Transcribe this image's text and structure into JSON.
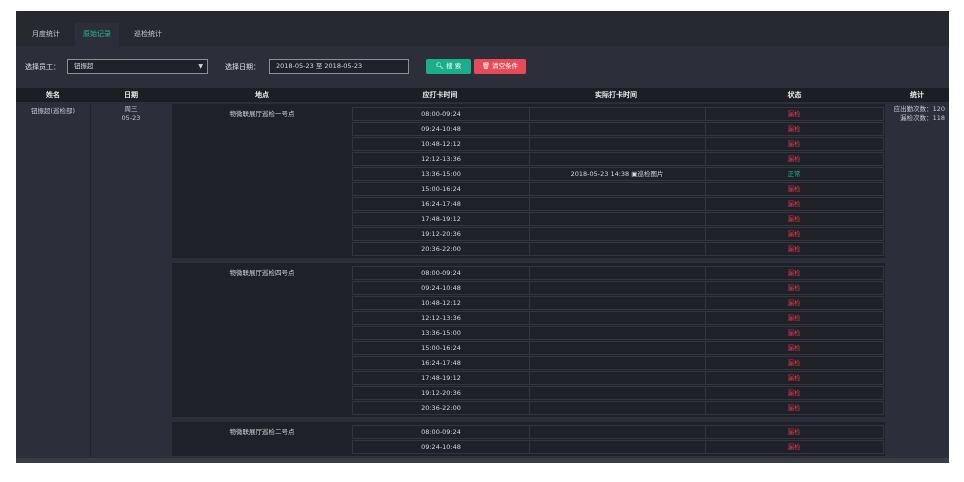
{
  "tabs": [
    "月度统计",
    "原始记录",
    "巡检统计"
  ],
  "active_tab": 1,
  "filter": {
    "employee_label": "选择员工：",
    "employee_value": "钮振超",
    "date_label": "选择日期：",
    "date_value": "2018-05-23 至 2018-05-23",
    "search_label": "搜 索",
    "clear_label": "清空条件"
  },
  "table": {
    "headers": [
      "姓名",
      "日期",
      "地点",
      "应打卡时间",
      "实际打卡时间",
      "状态",
      "统计"
    ],
    "name": "钮振超(巡检部)",
    "weekday": "周三",
    "date": "05-23",
    "stats": [
      "应出勤次数：120",
      "漏检次数：118"
    ],
    "locations": [
      {
        "name": "物微联展厅巡检一号点",
        "rows": [
          {
            "time": "08:00-09:24",
            "actual": "",
            "status": "漏检"
          },
          {
            "time": "09:24-10:48",
            "actual": "",
            "status": "漏检"
          },
          {
            "time": "10:48-12:12",
            "actual": "",
            "status": "漏检"
          },
          {
            "time": "12:12-13:36",
            "actual": "",
            "status": "漏检"
          },
          {
            "time": "13:36-15:00",
            "actual": "2018-05-23 14:38  ▣巡检图片",
            "status": "正常"
          },
          {
            "time": "15:00-16:24",
            "actual": "",
            "status": "漏检"
          },
          {
            "time": "16:24-17:48",
            "actual": "",
            "status": "漏检"
          },
          {
            "time": "17:48-19:12",
            "actual": "",
            "status": "漏检"
          },
          {
            "time": "19:12-20:36",
            "actual": "",
            "status": "漏检"
          },
          {
            "time": "20:36-22:00",
            "actual": "",
            "status": "漏检"
          }
        ]
      },
      {
        "name": "物微联展厅巡检四号点",
        "rows": [
          {
            "time": "08:00-09:24",
            "actual": "",
            "status": "漏检"
          },
          {
            "time": "09:24-10:48",
            "actual": "",
            "status": "漏检"
          },
          {
            "time": "10:48-12:12",
            "actual": "",
            "status": "漏检"
          },
          {
            "time": "12:12-13:36",
            "actual": "",
            "status": "漏检"
          },
          {
            "time": "13:36-15:00",
            "actual": "",
            "status": "漏检"
          },
          {
            "time": "15:00-16:24",
            "actual": "",
            "status": "漏检"
          },
          {
            "time": "16:24-17:48",
            "actual": "",
            "status": "漏检"
          },
          {
            "time": "17:48-19:12",
            "actual": "",
            "status": "漏检"
          },
          {
            "time": "19:12-20:36",
            "actual": "",
            "status": "漏检"
          },
          {
            "time": "20:36-22:00",
            "actual": "",
            "status": "漏检"
          }
        ]
      },
      {
        "name": "物微联展厅巡检二号点",
        "rows": [
          {
            "time": "08:00-09:24",
            "actual": "",
            "status": "漏检"
          },
          {
            "time": "09:24-10:48",
            "actual": "",
            "status": "漏检"
          }
        ]
      }
    ]
  }
}
